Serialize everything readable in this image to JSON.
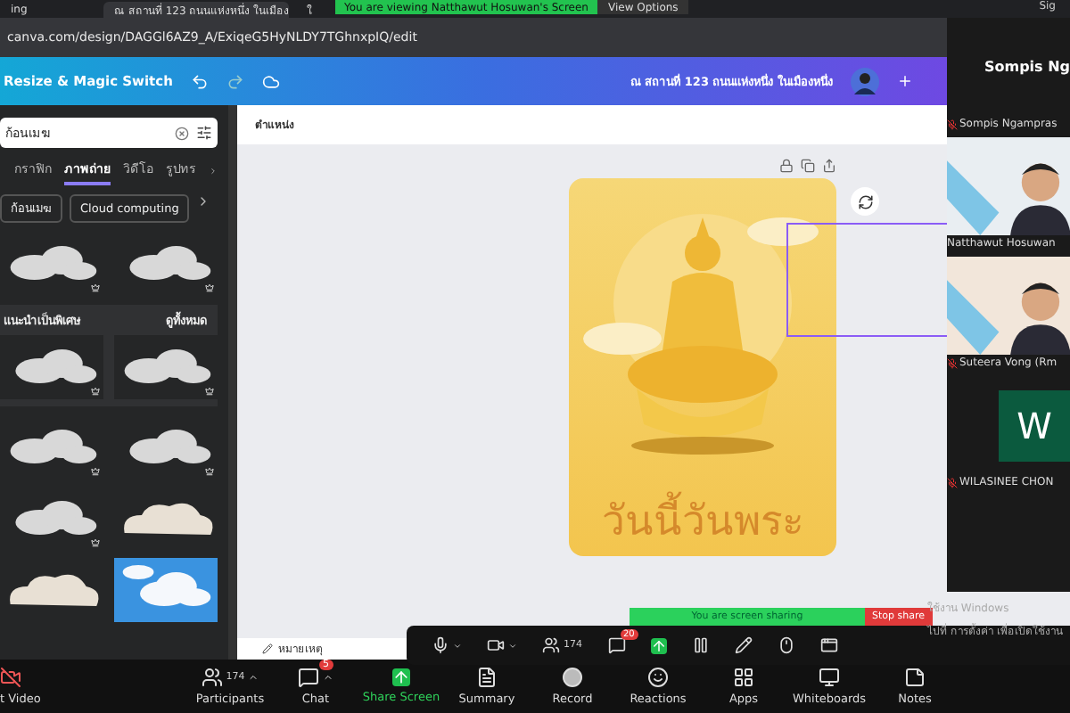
{
  "browser": {
    "tabs": [
      {
        "title": "ing",
        "selected": false
      },
      {
        "title": "ณ สถานที่ 123 ถนนแห่งหนึ่ง ในเมือง",
        "selected": true
      },
      {
        "title": "ใ",
        "selected": false
      }
    ],
    "url": "canva.com/design/DAGGl6AZ9_A/ExiqeG5HyNLDY7TGhnxpIQ/edit"
  },
  "zoom_banner": {
    "text": "You are viewing Natthawut Hosuwan's Screen",
    "menu": "View Options",
    "sign": "Sig"
  },
  "canva": {
    "resize": "Resize & Magic Switch",
    "title": "ณ สถานที่ 123 ถนนแห่งหนึ่ง ในเมืองหนึ่ง",
    "search": {
      "value": "ก้อนเมฆ"
    },
    "tabs": [
      {
        "label": "กราฟิก",
        "selected": false
      },
      {
        "label": "ภาพถ่าย",
        "selected": true
      },
      {
        "label": "วิดีโอ",
        "selected": false
      },
      {
        "label": "รูปทร",
        "selected": false
      }
    ],
    "chips": [
      "ก้อนเมฆ",
      "Cloud computing"
    ],
    "featured": {
      "title": "แนะนำเป็นพิเศษ",
      "link": "ดูทั้งหมด"
    },
    "position": "ตำแหน่ง",
    "notes": "หมายเหตุ",
    "design_text": "วันนี้วันพระ"
  },
  "participants": [
    {
      "kind": "name",
      "big": "Sompis Ng",
      "name": "Sompis Ngampras",
      "muted": true
    },
    {
      "kind": "video",
      "name": "Natthawut Hosuwan",
      "muted": false
    },
    {
      "kind": "video",
      "name": "Suteera Vong (Rm",
      "muted": true
    },
    {
      "kind": "initial",
      "big": "W",
      "name": "WILASINEE CHON",
      "muted": true
    }
  ],
  "sharing": {
    "text": "You are screen sharing",
    "stop": "Stop share"
  },
  "windows_notice": [
    "ใช้งาน Windows",
    "ไปที่ การตั้งค่า เพื่อเปิดใช้งาน"
  ],
  "meeting_toolbar": {
    "participant_count": "174",
    "chat_badge": "20"
  },
  "zoom_bar": [
    {
      "kind": "video",
      "label": "t Video"
    },
    {
      "kind": "participants",
      "label": "Participants",
      "count": "174"
    },
    {
      "kind": "chat",
      "label": "Chat",
      "badge": "5"
    },
    {
      "kind": "share",
      "label": "Share Screen"
    },
    {
      "kind": "summary",
      "label": "Summary"
    },
    {
      "kind": "record",
      "label": "Record"
    },
    {
      "kind": "reactions",
      "label": "Reactions"
    },
    {
      "kind": "apps",
      "label": "Apps"
    },
    {
      "kind": "whiteboards",
      "label": "Whiteboards"
    },
    {
      "kind": "notes",
      "label": "Notes"
    }
  ]
}
